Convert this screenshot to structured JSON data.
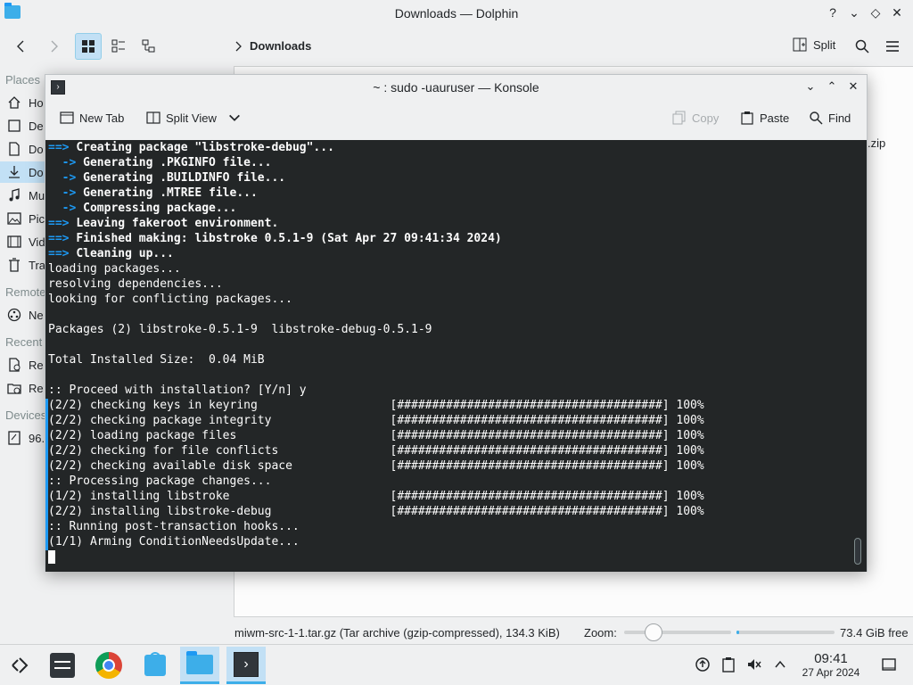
{
  "dolphin": {
    "title": "Downloads — Dolphin",
    "breadcrumb": "Downloads",
    "split_label": "Split",
    "places_header": "Places",
    "remote_header": "Remote",
    "recent_header": "Recent",
    "devices_header": "Devices",
    "places": [
      {
        "label": "Ho",
        "icon": "home-icon"
      },
      {
        "label": "De",
        "icon": "desktop-icon"
      },
      {
        "label": "Do",
        "icon": "documents-icon"
      },
      {
        "label": "Do",
        "icon": "downloads-icon"
      },
      {
        "label": "Mu",
        "icon": "music-icon"
      },
      {
        "label": "Pic",
        "icon": "pictures-icon"
      },
      {
        "label": "Vid",
        "icon": "videos-icon"
      },
      {
        "label": "Tra",
        "icon": "trash-icon"
      }
    ],
    "remote": [
      {
        "label": "Ne",
        "icon": "network-icon"
      }
    ],
    "recent": [
      {
        "label": "Re",
        "icon": "recent-files-icon"
      },
      {
        "label": "Re",
        "icon": "recent-locations-icon"
      }
    ],
    "devices": [
      {
        "label": "96.",
        "icon": "drive-icon"
      }
    ],
    "file_fragment": ".zip",
    "status_text": "miwm-src-1-1.tar.gz (Tar archive (gzip-compressed), 134.3 KiB)",
    "zoom_label": "Zoom:",
    "free_space": "73.4 GiB free"
  },
  "konsole": {
    "title": "~ : sudo -uauruser — Konsole",
    "toolbar": {
      "new_tab": "New Tab",
      "split_view": "Split View",
      "copy": "Copy",
      "paste": "Paste",
      "find": "Find"
    },
    "lines": [
      {
        "prefix": "==> ",
        "text": "Creating package \"libstroke-debug\"...",
        "style": "arrow"
      },
      {
        "prefix": "  -> ",
        "text": "Generating .PKGINFO file...",
        "style": "sub"
      },
      {
        "prefix": "  -> ",
        "text": "Generating .BUILDINFO file...",
        "style": "sub"
      },
      {
        "prefix": "  -> ",
        "text": "Generating .MTREE file...",
        "style": "sub"
      },
      {
        "prefix": "  -> ",
        "text": "Compressing package...",
        "style": "sub"
      },
      {
        "prefix": "==> ",
        "text": "Leaving fakeroot environment.",
        "style": "arrow"
      },
      {
        "prefix": "==> ",
        "text": "Finished making: libstroke 0.5.1-9 (Sat Apr 27 09:41:34 2024)",
        "style": "arrow"
      },
      {
        "prefix": "==> ",
        "text": "Cleaning up...",
        "style": "arrow"
      },
      {
        "prefix": "",
        "text": "loading packages...",
        "style": "plain"
      },
      {
        "prefix": "",
        "text": "resolving dependencies...",
        "style": "plain"
      },
      {
        "prefix": "",
        "text": "looking for conflicting packages...",
        "style": "plain"
      },
      {
        "prefix": "",
        "text": "",
        "style": "plain"
      },
      {
        "prefix": "",
        "text": "Packages (2) libstroke-0.5.1-9  libstroke-debug-0.5.1-9",
        "style": "plain"
      },
      {
        "prefix": "",
        "text": "",
        "style": "plain"
      },
      {
        "prefix": "",
        "text": "Total Installed Size:  0.04 MiB",
        "style": "plain"
      },
      {
        "prefix": "",
        "text": "",
        "style": "plain"
      },
      {
        "prefix": "",
        "text": ":: Proceed with installation? [Y/n] y",
        "style": "plain"
      },
      {
        "prefix": "",
        "text": "(2/2) checking keys in keyring                   [######################################] 100%",
        "style": "plain"
      },
      {
        "prefix": "",
        "text": "(2/2) checking package integrity                 [######################################] 100%",
        "style": "plain"
      },
      {
        "prefix": "",
        "text": "(2/2) loading package files                      [######################################] 100%",
        "style": "plain"
      },
      {
        "prefix": "",
        "text": "(2/2) checking for file conflicts                [######################################] 100%",
        "style": "plain"
      },
      {
        "prefix": "",
        "text": "(2/2) checking available disk space              [######################################] 100%",
        "style": "plain"
      },
      {
        "prefix": "",
        "text": ":: Processing package changes...",
        "style": "plain"
      },
      {
        "prefix": "",
        "text": "(1/2) installing libstroke                       [######################################] 100%",
        "style": "plain"
      },
      {
        "prefix": "",
        "text": "(2/2) installing libstroke-debug                 [######################################] 100%",
        "style": "plain"
      },
      {
        "prefix": "",
        "text": ":: Running post-transaction hooks...",
        "style": "plain"
      },
      {
        "prefix": "",
        "text": "(1/1) Arming ConditionNeedsUpdate...",
        "style": "plain"
      }
    ]
  },
  "taskbar": {
    "clock_time": "09:41",
    "clock_date": "27 Apr 2024"
  },
  "colors": {
    "accent": "#3daee9",
    "terminal_bg": "#232627",
    "arrow_blue": "#1d99f3"
  }
}
